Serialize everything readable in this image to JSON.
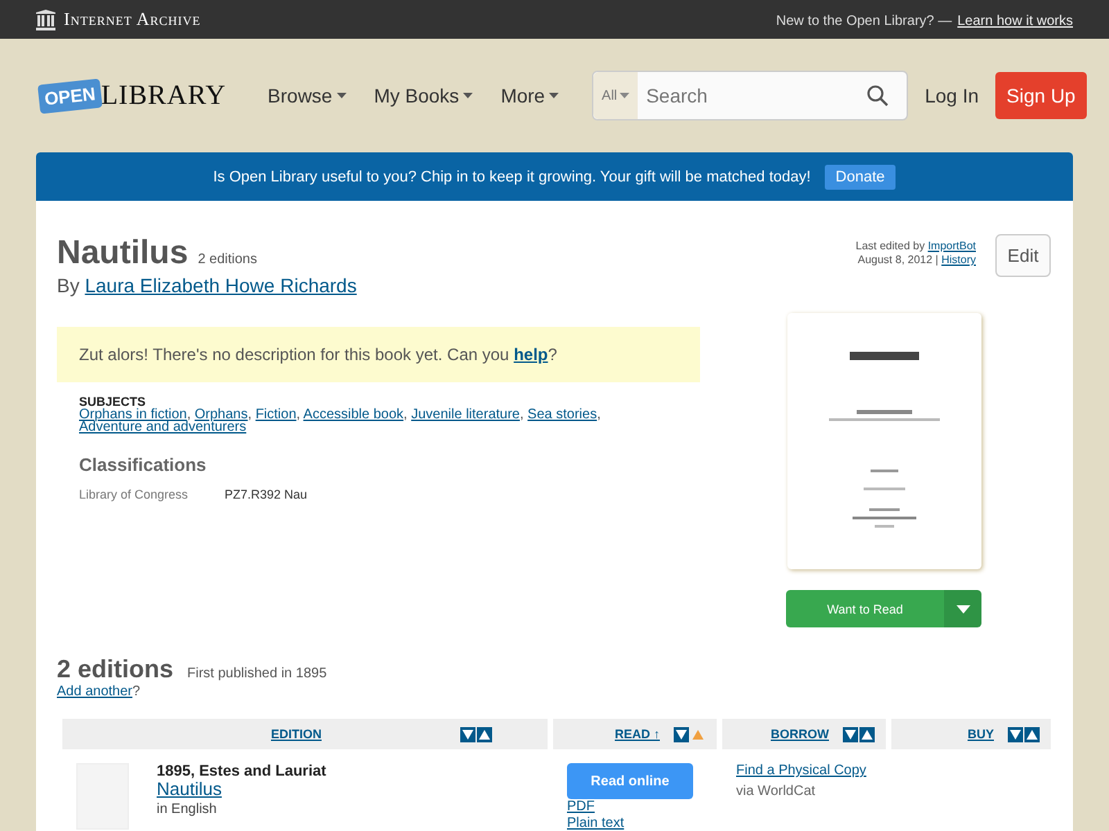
{
  "topbar": {
    "brand": "Internet Archive",
    "prompt": "New to the Open Library? —",
    "link": "Learn how it works"
  },
  "header": {
    "logo_badge": "OPEN",
    "logo_word": "LIBRARY",
    "nav": [
      "Browse",
      "My Books",
      "More"
    ],
    "search_scope": "All",
    "search_placeholder": "Search",
    "login": "Log In",
    "signup": "Sign Up"
  },
  "banner": {
    "text": "Is Open Library useful to you? Chip in to keep it growing. Your gift will be matched today!",
    "button": "Donate"
  },
  "book": {
    "title": "Nautilus",
    "editions_count": "2 editions",
    "by": "By",
    "author": "Laura Elizabeth Howe Richards",
    "edited_prefix": "Last edited by",
    "edited_by": "ImportBot",
    "edited_date": "August 8, 2012 |",
    "history": "History",
    "edit_button": "Edit",
    "description_notice": "Zut alors! There's no description for this book yet. Can you",
    "help_link": "help",
    "notice_end": "?",
    "subjects_heading": "SUBJECTS",
    "subject_separator": ",",
    "subjects": [
      "Orphans in fiction",
      "Orphans",
      "Fiction",
      "Accessible book",
      "Juvenile literature",
      "Sea stories",
      "Adventure and adventurers"
    ],
    "classifications_heading": "Classifications",
    "classifications": [
      {
        "label": "Library of Congress",
        "value": "PZ7.R392 Nau"
      }
    ],
    "want_button": "Want to Read"
  },
  "editions": {
    "heading": "2 editions",
    "first_published": "First published in 1895",
    "add_link": "Add another",
    "add_suffix": "?",
    "columns": [
      {
        "label": "EDITION",
        "sorted_ascending": false
      },
      {
        "label": "READ ↑",
        "sorted_ascending": true
      },
      {
        "label": "BORROW",
        "sorted_ascending": false
      },
      {
        "label": "BUY",
        "sorted_ascending": false
      }
    ],
    "rows": [
      {
        "publisher": "1895, Estes and Lauriat",
        "title": "Nautilus",
        "language": "in English",
        "read_button": "Read online",
        "formats": [
          "PDF",
          "Plain text"
        ],
        "borrow_link": "Find a Physical Copy",
        "borrow_via": "via WorldCat"
      }
    ]
  }
}
